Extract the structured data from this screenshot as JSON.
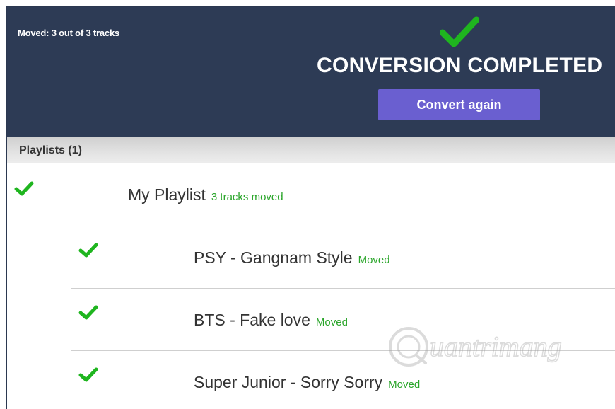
{
  "header": {
    "moved_summary": "Moved: 3 out of 3 tracks",
    "title": "CONVERSION COMPLETED",
    "convert_again_label": "Convert again",
    "check_icon": "check-icon",
    "background_color": "#2d3b55",
    "button_color": "#6a5fd0",
    "check_color": "#1fb51f"
  },
  "section": {
    "title": "Playlists (1)"
  },
  "playlist": {
    "name": "My Playlist",
    "status": "3 tracks moved"
  },
  "tracks": [
    {
      "title": "PSY - Gangnam Style",
      "status": "Moved"
    },
    {
      "title": "BTS - Fake love",
      "status": "Moved"
    },
    {
      "title": "Super Junior - Sorry Sorry",
      "status": "Moved"
    }
  ],
  "watermark": {
    "text": "uantrimang"
  }
}
